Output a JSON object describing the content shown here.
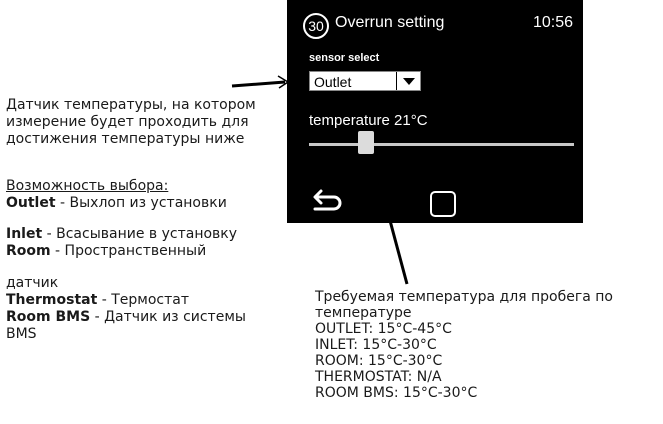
{
  "device": {
    "badge_number": "30",
    "title": "Overrun setting",
    "time": "10:56",
    "sensor_select_label": "sensor select",
    "sensor_selected": "Outlet",
    "temperature_label": "temperature 21°C",
    "slider_value_c": 21
  },
  "left_annotation": {
    "description": "Датчик температуры, на котором измерение будет проходить для достижения температуры ниже",
    "options_heading": "Возможность выбора:",
    "options": [
      {
        "name": "Outlet",
        "desc": " - Выхлоп из установки"
      },
      {
        "name": "Inlet",
        "desc": " - Всасывание в установку"
      },
      {
        "name": "Room",
        "desc": " - Пространственный"
      },
      {
        "name": "",
        "desc": "датчик"
      },
      {
        "name": "Thermostat",
        "desc": " - Термостат"
      },
      {
        "name": "Room BMS",
        "desc": " - Датчик из системы"
      },
      {
        "name": "",
        "desc": "BMS"
      }
    ]
  },
  "right_annotation": {
    "lines": [
      "Требуемая температура для пробега по",
      "температуре",
      "OUTLET: 15°C-45°C",
      "INLET: 15°C-30°C",
      "ROOM: 15°C-30°C",
      "THERMOSTAT: N/A",
      "ROOM BMS: 15°C-30°C"
    ]
  }
}
